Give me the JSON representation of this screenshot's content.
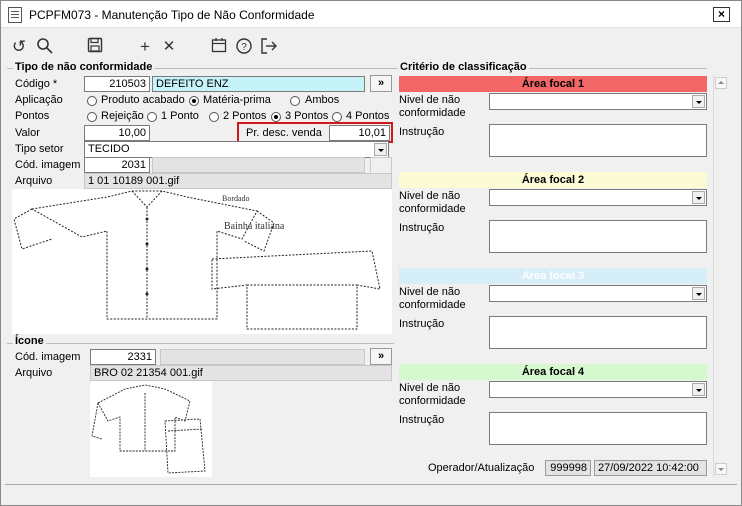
{
  "window": {
    "title": "PCPFM073 - Manutenção Tipo de Não Conformidade",
    "close_label": "×"
  },
  "toolbar": {
    "undo_icon": "↺",
    "search_icon": "⚲",
    "save_icon": "💾",
    "add_icon": "+",
    "remove_icon": "✕",
    "calendar_icon": "📅",
    "help_icon": "?",
    "exit_icon": "⇥"
  },
  "tipo": {
    "group_title": "Tipo de não conformidade",
    "codigo_label": "Código *",
    "codigo_value": "210503",
    "descricao_value": "DEFEITO ENZ",
    "lookup_label": "»",
    "aplicacao_label": "Aplicação",
    "aplicacao_options": [
      "Produto acabado",
      "Matéria-prima",
      "Ambos"
    ],
    "aplicacao_selected": "Matéria-prima",
    "pontos_label": "Pontos",
    "pontos_options": [
      "Rejeição",
      "1 Ponto",
      "2 Pontos",
      "3 Pontos",
      "4 Pontos"
    ],
    "pontos_selected": "3 Pontos",
    "valor_label": "Valor",
    "valor_value": "10,00",
    "pr_desc_label": "Pr. desc. venda",
    "pr_desc_value": "10,01",
    "tipo_setor_label": "Tipo setor",
    "tipo_setor_value": "TECIDO",
    "cod_imagem_label": "Cód. imagem",
    "cod_imagem_value": "2031",
    "arquivo_label": "Arquivo",
    "arquivo_value": "1 01 10189 001.gif",
    "image_caption_1": "Bordado",
    "image_caption_2": "Bainha italiana"
  },
  "icone": {
    "group_title": "Ícone",
    "cod_imagem_label": "Cód. imagem",
    "cod_imagem_value": "2331",
    "lookup_label": "»",
    "arquivo_label": "Arquivo",
    "arquivo_value": "BRO 02 21354 001.gif"
  },
  "criterio": {
    "group_title": "Critério de classificação",
    "nivel_label_1": "Nivel de não",
    "nivel_label_2": "conformidade",
    "instrucao_label": "Instrução",
    "areas": [
      {
        "title": "Área focal 1",
        "color": "#f26666"
      },
      {
        "title": "Área focal 2",
        "color": "#fbfbd6"
      },
      {
        "title": "Área focal 3",
        "color": "#d6eef8"
      },
      {
        "title": "Área focal 4",
        "color": "#d6f8cf"
      }
    ],
    "operador_label": "Operador/Atualização",
    "operador_value": "999998",
    "data_value": "27/09/2022 10:42:00"
  }
}
